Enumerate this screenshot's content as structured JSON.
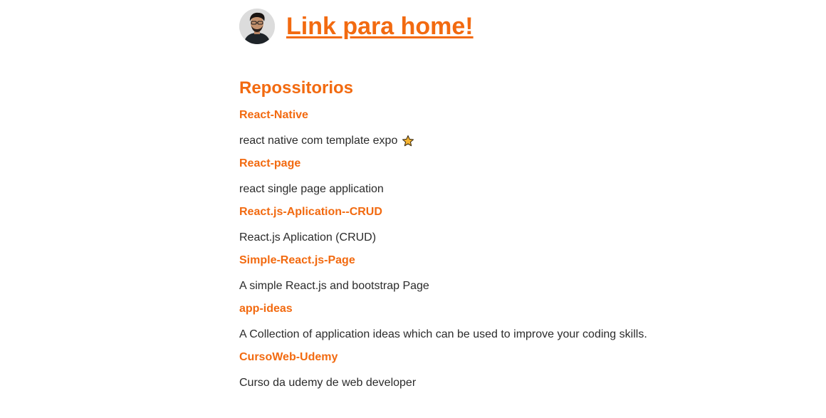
{
  "header": {
    "home_link": "Link para home!"
  },
  "section": {
    "title": "Repossitorios"
  },
  "repos": [
    {
      "name": "React-Native",
      "description": "react native com template expo",
      "has_star": true
    },
    {
      "name": "React-page",
      "description": "react single page application",
      "has_star": false
    },
    {
      "name": "React.js-Aplication--CRUD",
      "description": "React.js Aplication (CRUD)",
      "has_star": false
    },
    {
      "name": "Simple-React.js-Page",
      "description": "A simple React.js and bootstrap Page",
      "has_star": false
    },
    {
      "name": "app-ideas",
      "description": "A Collection of application ideas which can be used to improve your coding skills.",
      "has_star": false
    },
    {
      "name": "CursoWeb-Udemy",
      "description": "Curso da udemy de web developer",
      "has_star": false
    }
  ],
  "colors": {
    "accent": "#f26a10",
    "text": "#2b2b2b",
    "star_fill": "#f5b431"
  },
  "icons": {
    "avatar": "user-avatar-photo",
    "star": "star-emoji-icon"
  }
}
